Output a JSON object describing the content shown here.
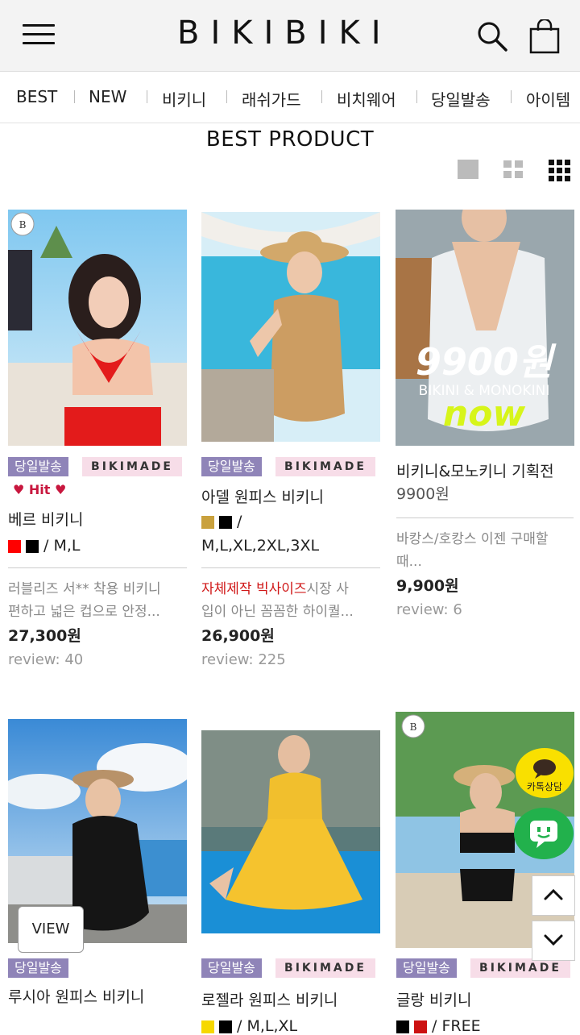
{
  "header": {
    "logo": "BIKIBIKI",
    "menu_icon": "hamburger-menu-icon",
    "search_icon": "search-icon",
    "cart_icon": "shopping-bag-icon"
  },
  "nav": [
    "BEST",
    "NEW",
    "비키니",
    "래쉬가드",
    "비치웨어",
    "당일발송",
    "아이템"
  ],
  "section_title": "BEST PRODUCT",
  "view_switch": [
    "grid-1-icon",
    "grid-2-icon",
    "grid-3-icon"
  ],
  "tags": {
    "same_day": "당일발송",
    "made": "BIKIMADE",
    "hit": "♥ Hit ♥"
  },
  "products": [
    {
      "name": "베르 비키니",
      "colors": [
        "#ff0000",
        "#000000"
      ],
      "sizes": "/ M,L",
      "desc1": "러블리즈 서** 착용 비키니",
      "desc2": "편하고 넓은 컵으로 안정...",
      "price": "27,300원",
      "review": "review: 40",
      "same_day": true,
      "made": true,
      "hit": true
    },
    {
      "name": "아델 원피스 비키니",
      "colors": [
        "#c9a13d",
        "#000000"
      ],
      "sizes_line1": "/",
      "sizes": "M,L,XL,2XL,3XL",
      "desc_red": "자체제작 빅사이즈",
      "desc1": "시장 사",
      "desc2": "입이 아닌 꼼꼼한 하이퀄...",
      "price": "26,900원",
      "review": "review: 225",
      "same_day": true,
      "made": true
    },
    {
      "name": "비키니&모노키니 기획전",
      "subprice": "9900원",
      "desc1": "바캉스/호캉스 이젠 구매할",
      "desc2": "때...",
      "price": "9,900원",
      "review": "review: 6",
      "banner_big": "9900원",
      "banner_sub": "BIKINI & MONOKINI",
      "banner_now": "now"
    },
    {
      "name": "루시아 원피스 비키니",
      "same_day": true
    },
    {
      "name": "로젤라 원피스 비키니",
      "colors": [
        "#f6d800",
        "#000000"
      ],
      "sizes": "/ M,L,XL",
      "same_day": true,
      "made": true
    },
    {
      "name": "글랑 비키니",
      "colors": [
        "#000000",
        "#cc1111"
      ],
      "sizes": "/ FREE",
      "same_day": true,
      "made": true
    }
  ],
  "view_button": "VIEW",
  "kakao_label": "카톡상담",
  "floating": {
    "chat_icon": "chat-bubble-icon",
    "up_icon": "chevron-up-icon",
    "down_icon": "chevron-down-icon"
  }
}
